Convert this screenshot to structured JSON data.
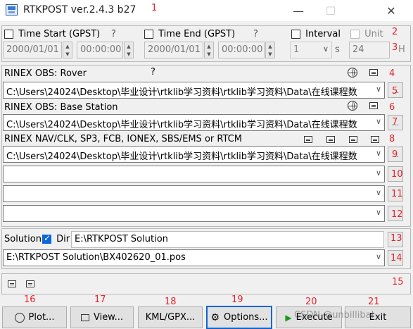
{
  "window": {
    "title": "RTKPOST ver.2.4.3 b27",
    "minimize": "—",
    "maximize": "☐",
    "close": "✕"
  },
  "time": {
    "start_label": "Time Start (GPST)",
    "start_help": "?",
    "start_date": "2000/01/01",
    "start_time": "00:00:00",
    "end_label": "Time End (GPST)",
    "end_help": "?",
    "end_date": "2000/01/01",
    "end_time": "00:00:00",
    "interval_label": "Interval",
    "interval_value": "1",
    "interval_unit": "s",
    "unit_label": "Unit",
    "unit_value": "24",
    "unit_suffix": "H"
  },
  "inputs": {
    "rover_label": "RINEX OBS: Rover",
    "rover_help": "?",
    "rover_path": "C:\\Users\\24024\\Desktop\\毕业设计\\rtklib学习资料\\rtklib学习资料\\Data\\在线课程数",
    "base_label": "RINEX OBS: Base Station",
    "base_path": "C:\\Users\\24024\\Desktop\\毕业设计\\rtklib学习资料\\rtklib学习资料\\Data\\在线课程数",
    "nav_label": "RINEX NAV/CLK, SP3, FCB, IONEX, SBS/EMS  or RTCM",
    "nav_path": "C:\\Users\\24024\\Desktop\\毕业设计\\rtklib学习资料\\rtklib学习资料\\Data\\在线课程数",
    "extra1": "",
    "extra2": "",
    "extra3": "",
    "browse": "..."
  },
  "solution": {
    "label": "Solution",
    "dir_label": "Dir",
    "dir_value": "E:\\RTKPOST Solution",
    "file_value": "E:\\RTKPOST Solution\\BX402620_01.pos"
  },
  "buttons": {
    "plot": "Plot...",
    "view": "View...",
    "kml": "KML/GPX...",
    "options": "Options...",
    "execute": "Execute",
    "exit": "Exit"
  },
  "overlay": {
    "watermark": "CSDN @unbillibal",
    "exec_ghost": "CSDN"
  },
  "markers": [
    "1",
    "2",
    "3",
    "4",
    "5",
    "6",
    "7",
    "8",
    "9",
    "10",
    "11",
    "12",
    "13",
    "14",
    "15",
    "16",
    "17",
    "18",
    "19",
    "20",
    "21"
  ],
  "colors": {
    "marker": "#e8222a",
    "accent": "#0a66d8",
    "execute_green": "#1a9a1a"
  }
}
